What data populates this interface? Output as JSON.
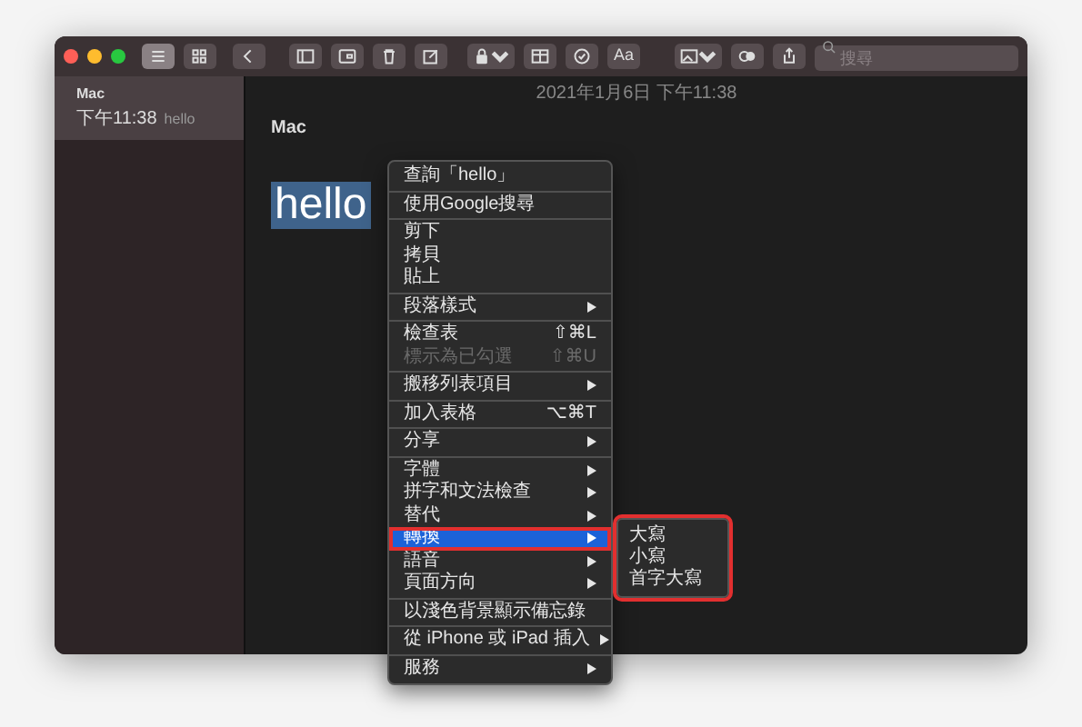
{
  "toolbar": {
    "view_toggle": [
      {
        "selected": true
      },
      {
        "selected": false
      }
    ],
    "format_button": "Aa",
    "search": {
      "placeholder": "搜尋"
    }
  },
  "notes": [
    {
      "title": "Mac",
      "time": "下午11:38",
      "preview": "hello",
      "selected": true
    }
  ],
  "editor": {
    "date": "2021年1月6日 下午11:38",
    "title": "Mac",
    "body": "hello",
    "body_selected": true
  },
  "context_menu": {
    "groups": [
      [
        {
          "label": "查詢「hello」",
          "submenu": false,
          "disabled": false,
          "selected": false,
          "highlight": false
        }
      ],
      [
        {
          "label": "使用Google搜尋",
          "submenu": false,
          "disabled": false,
          "selected": false,
          "highlight": false
        }
      ],
      [
        {
          "label": "剪下",
          "submenu": false,
          "disabled": false,
          "selected": false,
          "highlight": false
        },
        {
          "label": "拷貝",
          "submenu": false,
          "disabled": false,
          "selected": false,
          "highlight": false
        },
        {
          "label": "貼上",
          "submenu": false,
          "disabled": false,
          "selected": false,
          "highlight": false
        }
      ],
      [
        {
          "label": "段落樣式",
          "submenu": true,
          "disabled": false,
          "selected": false,
          "highlight": false
        }
      ],
      [
        {
          "label": "檢查表",
          "shortcut": "⇧⌘L",
          "submenu": false,
          "disabled": false,
          "selected": false,
          "highlight": false
        },
        {
          "label": "標示為已勾選",
          "shortcut": "⇧⌘U",
          "submenu": false,
          "disabled": true,
          "selected": false,
          "highlight": false
        }
      ],
      [
        {
          "label": "搬移列表項目",
          "submenu": true,
          "disabled": false,
          "selected": false,
          "highlight": false
        }
      ],
      [
        {
          "label": "加入表格",
          "shortcut": "⌥⌘T",
          "submenu": false,
          "disabled": false,
          "selected": false,
          "highlight": false
        }
      ],
      [
        {
          "label": "分享",
          "submenu": true,
          "disabled": false,
          "selected": false,
          "highlight": false
        }
      ],
      [
        {
          "label": "字體",
          "submenu": true,
          "disabled": false,
          "selected": false,
          "highlight": false
        },
        {
          "label": "拼字和文法檢查",
          "submenu": true,
          "disabled": false,
          "selected": false,
          "highlight": false
        },
        {
          "label": "替代",
          "submenu": true,
          "disabled": false,
          "selected": false,
          "highlight": false
        },
        {
          "label": "轉換",
          "submenu": true,
          "disabled": false,
          "selected": true,
          "highlight": true
        },
        {
          "label": "語音",
          "submenu": true,
          "disabled": false,
          "selected": false,
          "highlight": false
        },
        {
          "label": "頁面方向",
          "submenu": true,
          "disabled": false,
          "selected": false,
          "highlight": false
        }
      ],
      [
        {
          "label": "以淺色背景顯示備忘錄",
          "submenu": false,
          "disabled": false,
          "selected": false,
          "highlight": false
        }
      ],
      [
        {
          "label": "從 iPhone 或 iPad 插入",
          "submenu": true,
          "disabled": false,
          "selected": false,
          "highlight": false
        }
      ],
      [
        {
          "label": "服務",
          "submenu": true,
          "disabled": false,
          "selected": false,
          "highlight": false
        }
      ]
    ],
    "submenu": {
      "highlight": true,
      "items": [
        "大寫",
        "小寫",
        "首字大寫"
      ]
    }
  }
}
